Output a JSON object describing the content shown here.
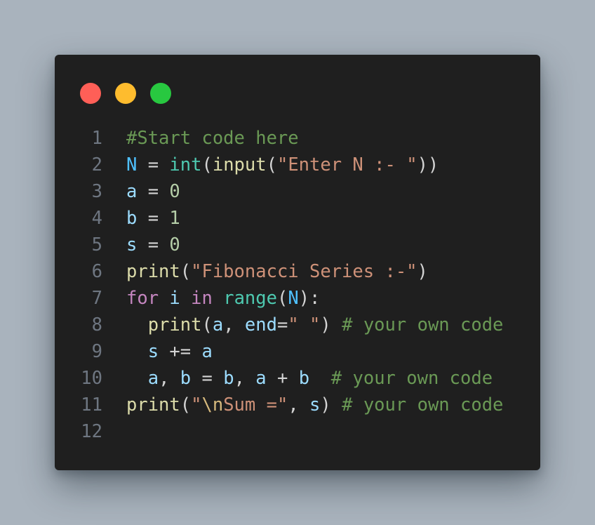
{
  "window": {
    "buttons": [
      {
        "name": "close",
        "color": "#ff5f57"
      },
      {
        "name": "minimize",
        "color": "#febc2e"
      },
      {
        "name": "maximize",
        "color": "#28c840"
      }
    ]
  },
  "colors": {
    "background": "#a9b3bd",
    "editor_background": "#1f1f1f",
    "line_number": "#6e7681",
    "comment": "#6a9955",
    "variable": "#9cdcfe",
    "constant": "#4fc1ff",
    "builtin": "#4ec9b0",
    "function": "#dcdcaa",
    "string": "#ce9178",
    "number": "#b5cea8",
    "keyword": "#c586c0"
  },
  "code": {
    "lines": [
      {
        "number": "1",
        "tokens": [
          {
            "t": "#Start code here",
            "k": "comment"
          }
        ]
      },
      {
        "number": "2",
        "tokens": [
          {
            "t": "N",
            "k": "const"
          },
          {
            "t": " = ",
            "k": "op"
          },
          {
            "t": "int",
            "k": "builtin"
          },
          {
            "t": "(",
            "k": "punc"
          },
          {
            "t": "input",
            "k": "func"
          },
          {
            "t": "(",
            "k": "punc"
          },
          {
            "t": "\"Enter N :- \"",
            "k": "string"
          },
          {
            "t": "))",
            "k": "punc"
          }
        ]
      },
      {
        "number": "3",
        "tokens": [
          {
            "t": "a",
            "k": "var"
          },
          {
            "t": " = ",
            "k": "op"
          },
          {
            "t": "0",
            "k": "number"
          }
        ]
      },
      {
        "number": "4",
        "tokens": [
          {
            "t": "b",
            "k": "var"
          },
          {
            "t": " = ",
            "k": "op"
          },
          {
            "t": "1",
            "k": "number"
          }
        ]
      },
      {
        "number": "5",
        "tokens": [
          {
            "t": "s",
            "k": "var"
          },
          {
            "t": " = ",
            "k": "op"
          },
          {
            "t": "0",
            "k": "number"
          }
        ]
      },
      {
        "number": "6",
        "tokens": [
          {
            "t": "print",
            "k": "func"
          },
          {
            "t": "(",
            "k": "punc"
          },
          {
            "t": "\"Fibonacci Series :-\"",
            "k": "string"
          },
          {
            "t": ")",
            "k": "punc"
          }
        ]
      },
      {
        "number": "7",
        "tokens": [
          {
            "t": "for",
            "k": "keyword"
          },
          {
            "t": " ",
            "k": "op"
          },
          {
            "t": "i",
            "k": "var"
          },
          {
            "t": " ",
            "k": "op"
          },
          {
            "t": "in",
            "k": "keyword"
          },
          {
            "t": " ",
            "k": "op"
          },
          {
            "t": "range",
            "k": "builtin"
          },
          {
            "t": "(",
            "k": "punc"
          },
          {
            "t": "N",
            "k": "const"
          },
          {
            "t": "):",
            "k": "punc"
          }
        ]
      },
      {
        "number": "8",
        "tokens": [
          {
            "t": "  ",
            "k": "op"
          },
          {
            "t": "print",
            "k": "func"
          },
          {
            "t": "(",
            "k": "punc"
          },
          {
            "t": "a",
            "k": "var"
          },
          {
            "t": ", ",
            "k": "punc"
          },
          {
            "t": "end",
            "k": "param"
          },
          {
            "t": "=",
            "k": "op"
          },
          {
            "t": "\" \"",
            "k": "string"
          },
          {
            "t": ") ",
            "k": "punc"
          },
          {
            "t": "# your own code",
            "k": "comment"
          }
        ]
      },
      {
        "number": "9",
        "tokens": [
          {
            "t": "  ",
            "k": "op"
          },
          {
            "t": "s",
            "k": "var"
          },
          {
            "t": " += ",
            "k": "op"
          },
          {
            "t": "a",
            "k": "var"
          }
        ]
      },
      {
        "number": "10",
        "tokens": [
          {
            "t": "  ",
            "k": "op"
          },
          {
            "t": "a",
            "k": "var"
          },
          {
            "t": ", ",
            "k": "punc"
          },
          {
            "t": "b",
            "k": "var"
          },
          {
            "t": " = ",
            "k": "op"
          },
          {
            "t": "b",
            "k": "var"
          },
          {
            "t": ", ",
            "k": "punc"
          },
          {
            "t": "a",
            "k": "var"
          },
          {
            "t": " + ",
            "k": "op"
          },
          {
            "t": "b",
            "k": "var"
          },
          {
            "t": "  ",
            "k": "op"
          },
          {
            "t": "# your own code",
            "k": "comment"
          }
        ]
      },
      {
        "number": "11",
        "tokens": [
          {
            "t": "print",
            "k": "func"
          },
          {
            "t": "(",
            "k": "punc"
          },
          {
            "t": "\"",
            "k": "string"
          },
          {
            "t": "\\n",
            "k": "escape"
          },
          {
            "t": "Sum =\"",
            "k": "string"
          },
          {
            "t": ", ",
            "k": "punc"
          },
          {
            "t": "s",
            "k": "var"
          },
          {
            "t": ") ",
            "k": "punc"
          },
          {
            "t": "# your own code",
            "k": "comment"
          }
        ]
      },
      {
        "number": "12",
        "tokens": []
      }
    ]
  }
}
